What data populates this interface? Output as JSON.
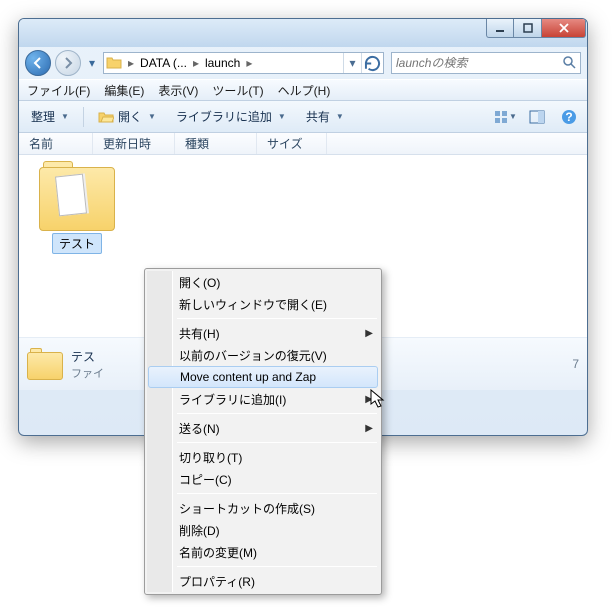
{
  "title_buttons": {
    "min": "minimize",
    "max": "maximize",
    "close": "close"
  },
  "breadcrumb": {
    "seg1": "DATA (...",
    "seg2": "launch"
  },
  "search": {
    "placeholder": "launchの検索"
  },
  "menu": {
    "file": "ファイル(F)",
    "edit": "編集(E)",
    "view": "表示(V)",
    "tools": "ツール(T)",
    "help": "ヘルプ(H)"
  },
  "toolbar": {
    "organize": "整理",
    "open": "開く",
    "addlib": "ライブラリに追加",
    "share": "共有"
  },
  "columns": {
    "name": "名前",
    "date": "更新日時",
    "type": "種類",
    "size": "サイズ"
  },
  "item": {
    "label": "テスト"
  },
  "details": {
    "title": "テス",
    "subtitle": "ファイ",
    "date_trail": "7"
  },
  "context_menu": {
    "open": "開く(O)",
    "new_window": "新しいウィンドウで開く(E)",
    "share": "共有(H)",
    "restore_prev": "以前のバージョンの復元(V)",
    "move_zap": "Move content up and Zap",
    "addlib": "ライブラリに追加(I)",
    "sendto": "送る(N)",
    "cut": "切り取り(T)",
    "copy": "コピー(C)",
    "shortcut": "ショートカットの作成(S)",
    "delete": "削除(D)",
    "rename": "名前の変更(M)",
    "properties": "プロパティ(R)"
  }
}
